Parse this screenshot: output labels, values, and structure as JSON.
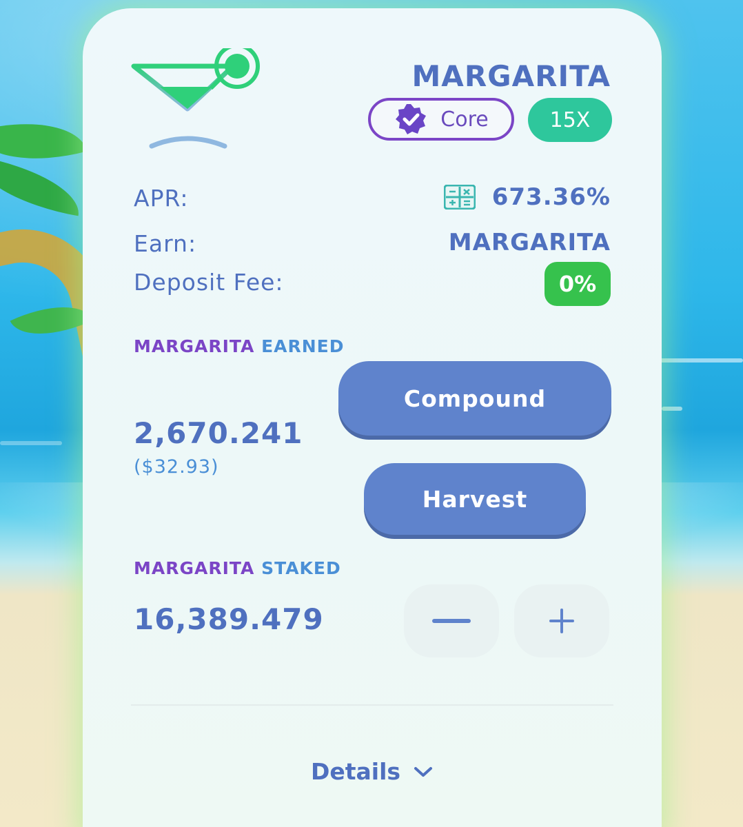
{
  "pool": {
    "name": "MARGARITA",
    "core_label": "Core",
    "multiplier": "15X",
    "apr_label": "APR:",
    "apr_value": "673.36%",
    "earn_label": "Earn:",
    "earn_value": "MARGARITA",
    "fee_label": "Deposit Fee:",
    "fee_value": "0%"
  },
  "earned": {
    "token": "MARGARITA",
    "kind": "EARNED",
    "amount": "2,670.241",
    "usd": "($32.93)",
    "compound_label": "Compound",
    "harvest_label": "Harvest"
  },
  "staked": {
    "token": "MARGARITA",
    "kind": "STAKED",
    "amount": "16,389.479"
  },
  "footer": {
    "details_label": "Details"
  },
  "icons": {
    "pool_logo": "cocktail-glass-icon",
    "verified": "verified-badge-icon",
    "calculator": "calculator-icon",
    "minus": "minus-icon",
    "plus": "plus-icon",
    "chevron": "chevron-down-icon"
  },
  "colors": {
    "accent": "#4f70bf",
    "button": "#5f83cc",
    "core_purple": "#7b45c6",
    "multiplier_green": "#2ec79c",
    "fee_green": "#36c24d"
  }
}
